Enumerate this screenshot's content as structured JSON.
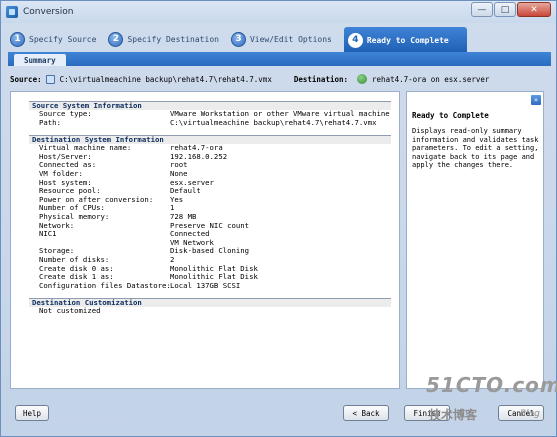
{
  "window": {
    "title": "Conversion"
  },
  "steps": [
    {
      "num": "1",
      "label": "Specify Source"
    },
    {
      "num": "2",
      "label": "Specify Destination"
    },
    {
      "num": "3",
      "label": "View/Edit Options"
    },
    {
      "num": "4",
      "label": "Ready to Complete"
    }
  ],
  "subtab": "Summary",
  "pathbar": {
    "source_label": "Source:",
    "source_value": "C:\\virtualmeachine backup\\rehat4.7\\rehat4.7.vmx",
    "destination_label": "Destination:",
    "destination_value": "rehat4.7-ora on esx.server"
  },
  "source_section": {
    "header": "Source System Information",
    "rows": [
      {
        "key": "Source type:",
        "value": "VMware Workstation or other VMware virtual machine"
      },
      {
        "key": "Path:",
        "value": "C:\\virtualmeachine backup\\rehat4.7\\rehat4.7.vmx"
      }
    ]
  },
  "destination_section": {
    "header": "Destination System Information",
    "rows": [
      {
        "key": "Virtual machine name:",
        "value": "rehat4.7-ora"
      },
      {
        "key": "Host/Server:",
        "value": "192.168.0.252"
      },
      {
        "key": "Connected as:",
        "value": "root"
      },
      {
        "key": "VM folder:",
        "value": "None"
      },
      {
        "key": "Host system:",
        "value": "esx.server"
      },
      {
        "key": "Resource pool:",
        "value": "Default"
      },
      {
        "key": "Power on after conversion:",
        "value": "Yes"
      },
      {
        "key": "Number of CPUs:",
        "value": "1"
      },
      {
        "key": "Physical memory:",
        "value": "728 MB"
      },
      {
        "key": "Network:",
        "value": "Preserve NIC count"
      },
      {
        "key": "NIC1",
        "value": "Connected"
      },
      {
        "key": "",
        "value": "VM Network"
      },
      {
        "key": "Storage:",
        "value": "Disk-based Cloning"
      },
      {
        "key": "Number of disks:",
        "value": "2"
      },
      {
        "key": "Create disk 0 as:",
        "value": "Monolithic Flat Disk"
      },
      {
        "key": "Create disk 1 as:",
        "value": "Monolithic Flat Disk"
      },
      {
        "key": "Configuration files Datastore:",
        "value": "Local 137GB SCSI"
      }
    ]
  },
  "customization_section": {
    "header": "Destination Customization",
    "rows": [
      {
        "key": "Not customized",
        "value": ""
      }
    ]
  },
  "side_panel": {
    "title": "Ready to Complete",
    "body": "Displays read-only summary information and validates task parameters. To edit a setting, navigate back to its page and apply the changes there."
  },
  "buttons": {
    "help": "Help",
    "back": "< Back",
    "finish": "Finish",
    "cancel": "Cancel"
  },
  "watermark": {
    "big": "51CTO.com",
    "small": "技术博客",
    "blog": "Blog"
  },
  "colors": {
    "accent": "#2a6cc0",
    "section_header_text": "#0e2f60"
  }
}
